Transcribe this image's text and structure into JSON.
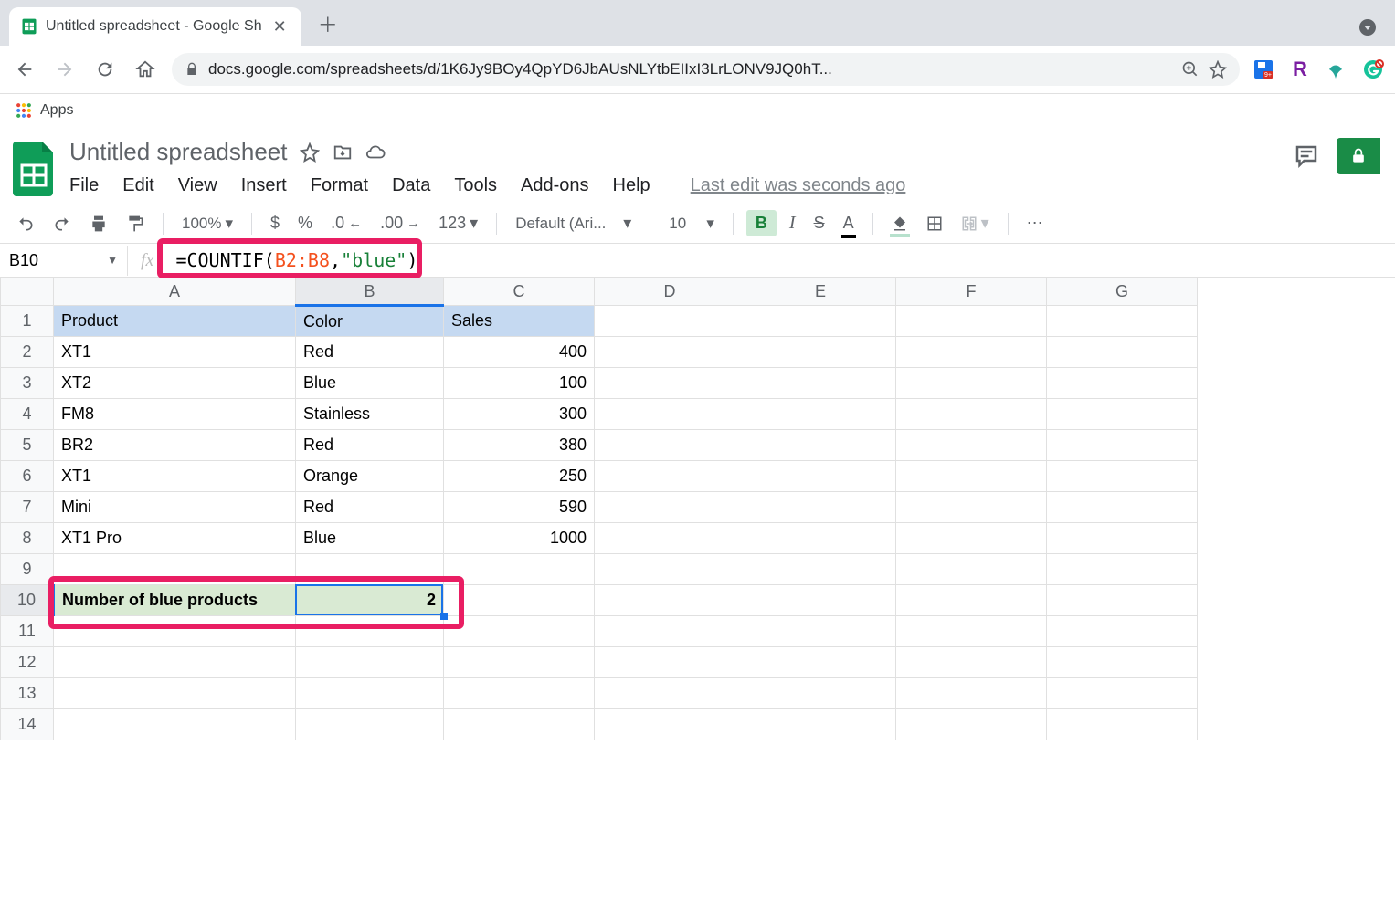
{
  "browser": {
    "tab_title": "Untitled spreadsheet - Google Sh",
    "url": "docs.google.com/spreadsheets/d/1K6Jy9BOy4QpYD6JbAUsNLYtbEIIxI3LrLONV9JQ0hT...",
    "bookmarks_label": "Apps",
    "ext_badge": "9+"
  },
  "doc": {
    "title": "Untitled spreadsheet",
    "menus": [
      "File",
      "Edit",
      "View",
      "Insert",
      "Format",
      "Data",
      "Tools",
      "Add-ons",
      "Help"
    ],
    "last_edit": "Last edit was seconds ago"
  },
  "toolbar": {
    "zoom": "100%",
    "font": "Default (Ari...",
    "font_size": "10",
    "num_format": "123"
  },
  "formula_bar": {
    "cell_ref": "B10",
    "prefix": "=COUNTIF(",
    "range": "B2:B8",
    "sep": ",",
    "str": "\"blue\"",
    "suffix": ")"
  },
  "grid": {
    "columns": [
      "A",
      "B",
      "C",
      "D",
      "E",
      "F",
      "G"
    ],
    "row_count": 14,
    "headers": {
      "A": "Product",
      "B": "Color",
      "C": "Sales"
    },
    "rows": [
      {
        "A": "XT1",
        "B": "Red",
        "C": 400
      },
      {
        "A": "XT2",
        "B": "Blue",
        "C": 100
      },
      {
        "A": "FM8",
        "B": "Stainless",
        "C": 300
      },
      {
        "A": "BR2",
        "B": "Red",
        "C": 380
      },
      {
        "A": "XT1",
        "B": "Orange",
        "C": 250
      },
      {
        "A": "Mini",
        "B": "Red",
        "C": 590
      },
      {
        "A": "XT1 Pro",
        "B": "Blue",
        "C": 1000
      }
    ],
    "row10": {
      "label": "Number of blue products",
      "value": 2
    },
    "selected_cell": "B10"
  }
}
